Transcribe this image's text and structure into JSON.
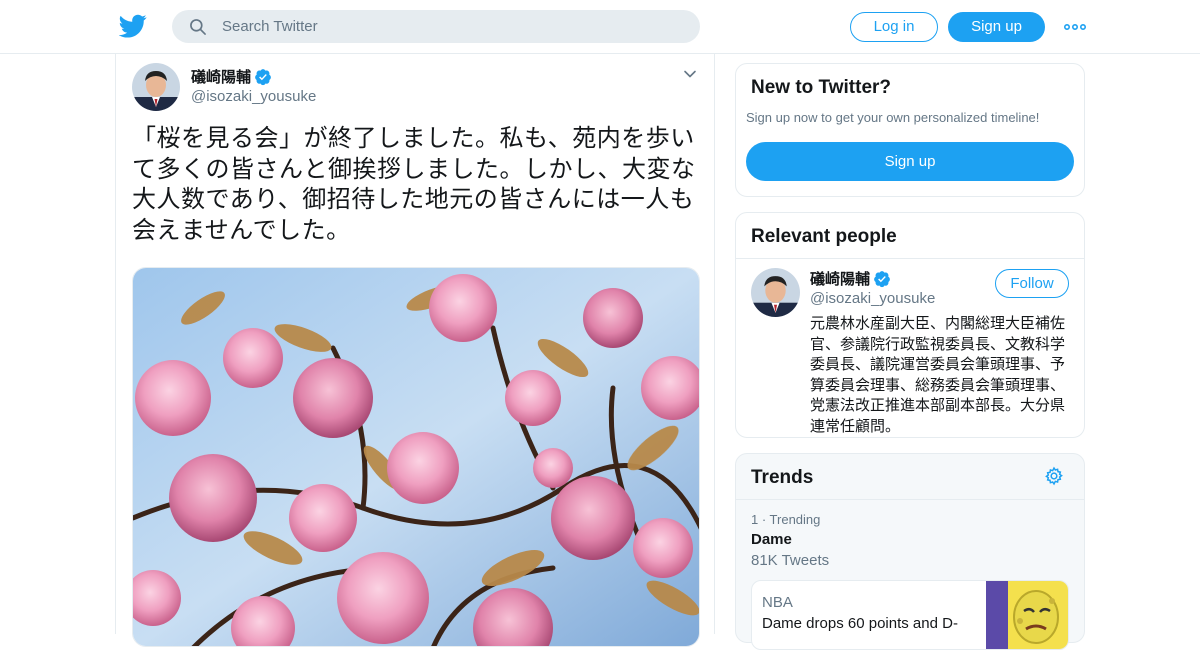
{
  "header": {
    "search_placeholder": "Search Twitter",
    "login_label": "Log in",
    "signup_label": "Sign up",
    "logo_icon": "twitter-bird-icon",
    "more_icon": "more-dots-icon"
  },
  "tweet": {
    "author_name": "礒崎陽輔",
    "author_handle": "@isozaki_yousuke",
    "verified": true,
    "text": "「桜を見る会」が終了しました。私も、苑内を歩いて多くの皆さんと御挨拶しました。しかし、大変な大人数であり、御招待した地元の皆さんには一人も会えませんでした。",
    "media_description": "cherry-blossoms-photo"
  },
  "sidebar": {
    "new_to_twitter": {
      "title": "New to Twitter?",
      "subtitle": "Sign up now to get your own personalized timeline!",
      "button_label": "Sign up"
    },
    "relevant_people": {
      "title": "Relevant people",
      "person": {
        "name": "礒崎陽輔",
        "handle": "@isozaki_yousuke",
        "follow_label": "Follow",
        "bio": "元農林水産副大臣、内閣総理大臣補佐官、参議院行政監視委員長、文教科学委員長、議院運営委員会筆頭理事、予算委員会理事、総務委員会筆頭理事、党憲法改正推進本部副本部長。大分県連常任顧問。"
      }
    },
    "trends": {
      "title": "Trends",
      "items": [
        {
          "rank": "1 · Trending",
          "name": "Dame",
          "count": "81K Tweets",
          "news": {
            "source": "NBA",
            "headline": "Dame drops 60 points and D-"
          }
        }
      ]
    }
  },
  "colors": {
    "brand": "#1da1f2",
    "text_primary": "#14171a",
    "text_secondary": "#657786",
    "border": "#e6ecf0"
  }
}
